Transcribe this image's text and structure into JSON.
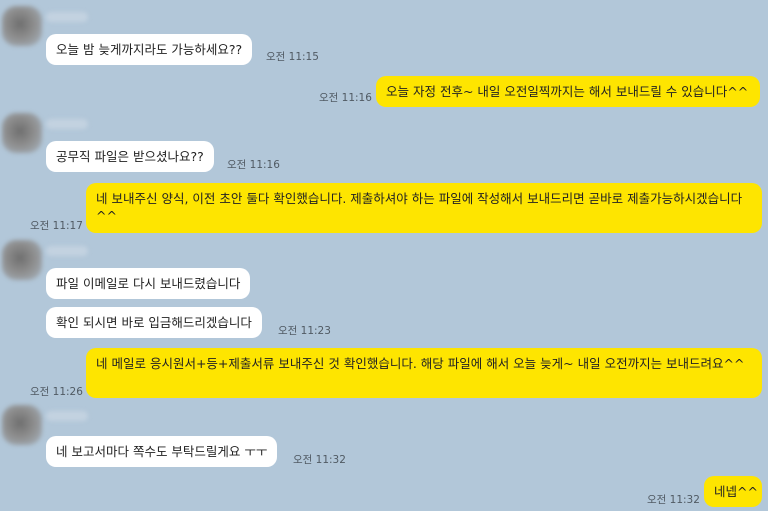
{
  "chat": {
    "messages": [
      {
        "side": "in",
        "text": "오늘 밤 늦게까지라도 가능하세요??",
        "time": "오전 11:15"
      },
      {
        "side": "out",
        "text": "오늘 자정 전후~ 내일 오전일찍까지는 해서 보내드릴 수 있습니다^^",
        "time": "오전 11:16"
      },
      {
        "side": "in",
        "text": "공무직 파일은 받으셨나요??",
        "time": "오전 11:16"
      },
      {
        "side": "out",
        "text": "네 보내주신 양식, 이전 초안 둘다 확인했습니다. 제출하셔야 하는 파일에 작성해서 보내드리면 곧바로 제출가능하시겠습니다^^",
        "time": "오전 11:17"
      },
      {
        "side": "in",
        "text": "파일 이메일로 다시 보내드렸습니다",
        "time": ""
      },
      {
        "side": "in",
        "text": "확인 되시면 바로 입금해드리겠습니다",
        "time": "오전 11:23"
      },
      {
        "side": "out",
        "text": "네 메일로 응시원서+등+제출서류 보내주신 것 확인했습니다. 해당 파일에 해서 오늘 늦게~ 내일 오전까지는 보내드려요^^",
        "time": "오전 11:26"
      },
      {
        "side": "in",
        "text": "네 보고서마다 쪽수도 부탁드릴게요 ㅜㅜ",
        "time": "오전 11:32"
      },
      {
        "side": "out",
        "text": "네넵^^",
        "time": "오전 11:32"
      }
    ]
  },
  "colors": {
    "background": "#b2c7d9",
    "incoming_bubble": "#ffffff",
    "outgoing_bubble": "#fee500",
    "timestamp": "#505a63"
  }
}
